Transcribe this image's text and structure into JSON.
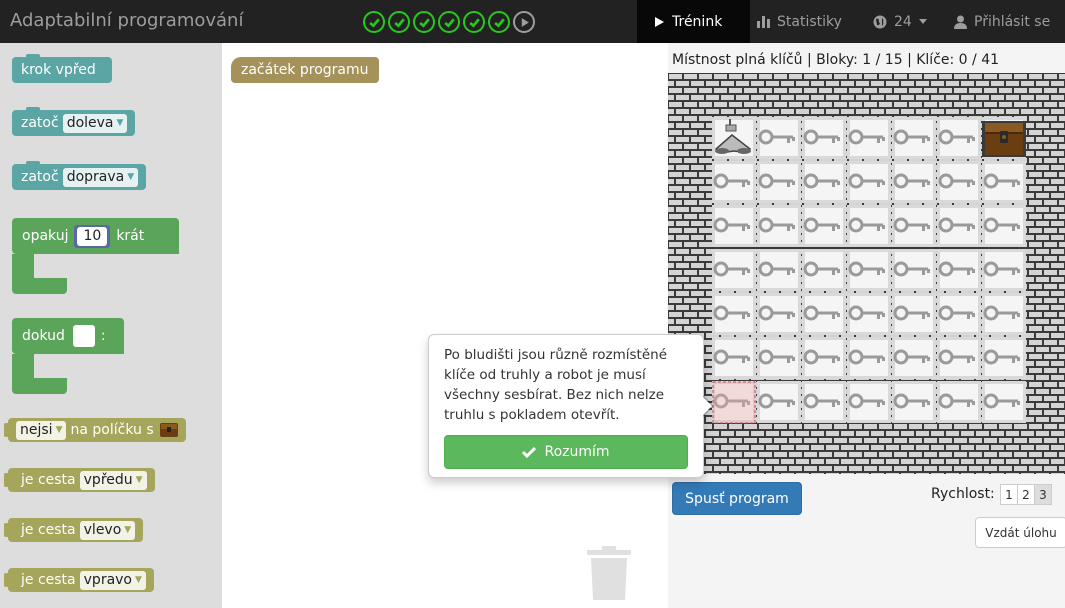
{
  "app": {
    "title": "Adaptabilní programování"
  },
  "progress": {
    "completed": 6,
    "total": 7
  },
  "nav": {
    "training": "Trénink",
    "stats": "Statistiky",
    "language_count": "24",
    "login": "Přihlásit se"
  },
  "toolbox": {
    "forward": "krok vpřed",
    "turn_left_label": "zatoč",
    "turn_left_value": "doleva",
    "turn_right_label": "zatoč",
    "turn_right_value": "doprava",
    "repeat_label": "opakuj",
    "repeat_count": "10",
    "repeat_suffix": "krát",
    "while_label": "dokud",
    "while_colon": ":",
    "no_item_value": "nejsi",
    "on_tile_label": "na políčku s",
    "path_label": "je cesta",
    "path_forward": "vpředu",
    "path_left": "vlevo",
    "path_right": "vpravo"
  },
  "workspace": {
    "start_block": "začátek programu"
  },
  "game": {
    "status": "Místnost plná klíčů | Bloky: 1 / 15 | Klíče: 0 / 41",
    "run_button": "Spusť program",
    "speed_label": "Rychlost:",
    "speed_options": [
      "1",
      "2",
      "3"
    ],
    "speed_selected": "3",
    "give_up": "Vzdát úlohu"
  },
  "popover": {
    "text": "Po bludišti jsou různě rozmístěné klíče od truhly a robot je musí všechny sesbírat. Bez nich nelze truhlu s pokladem otevřít.",
    "button": "Rozumím"
  },
  "colors": {
    "navbar": "#222222",
    "check_green": "#28c81e",
    "block_teal": "#5ba5a5",
    "block_green": "#5ba55b",
    "block_olive": "#a5a55b",
    "block_start": "#a5925b",
    "primary": "#337ab7",
    "success": "#5cb85c"
  },
  "icons": [
    "check-icon",
    "play-icon",
    "bar-chart-icon",
    "globe-icon",
    "user-icon",
    "trash-icon",
    "key-icon",
    "chest-icon",
    "robot-icon",
    "checkmark-icon"
  ]
}
